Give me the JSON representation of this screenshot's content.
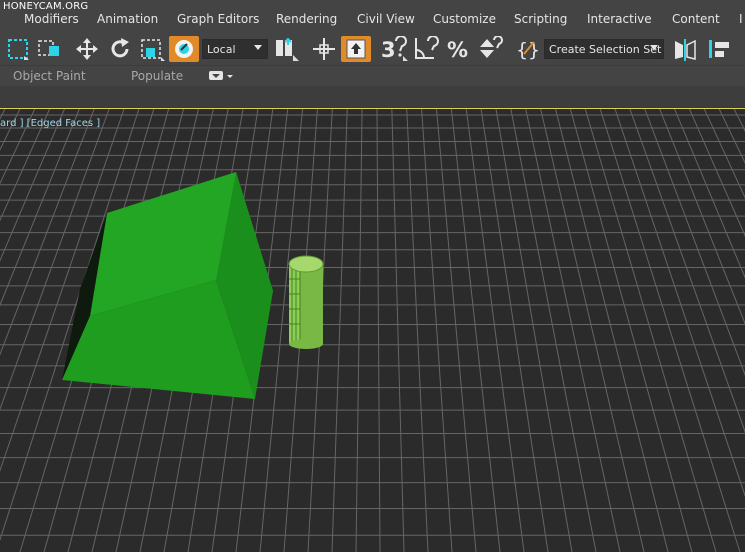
{
  "watermark": "HONEYCAM.ORG",
  "menubar": {
    "items": [
      "Modifiers",
      "Animation",
      "Graph Editors",
      "Rendering",
      "Civil View",
      "Customize",
      "Scripting",
      "Interactive",
      "Content",
      "I"
    ]
  },
  "toolbar": {
    "coord_system": "Local",
    "selection_set_placeholder": "Create Selection Set",
    "icons": [
      "select-region-icon",
      "window-crossing-icon",
      "move-icon",
      "rotate-icon",
      "scale-icon",
      "select-place-icon",
      "pivot-icon",
      "manipulate-icon",
      "keyboard-shortcut-icon",
      "snap-3d-icon",
      "angle-snap-icon",
      "percent-snap-icon",
      "spinner-snap-icon",
      "edit-named-sets-icon",
      "mirror-icon",
      "align-icon"
    ]
  },
  "ribbon": {
    "object_paint": "Object Paint",
    "populate": "Populate"
  },
  "viewport": {
    "label": "ard ] [Edged Faces ]",
    "colors": {
      "grid": "#6e6e6e",
      "background": "#2b2b2b",
      "object_green": "#1ea51e",
      "cylinder_green": "#7cc245"
    },
    "objects": [
      "box-object",
      "cylinder-object"
    ]
  }
}
